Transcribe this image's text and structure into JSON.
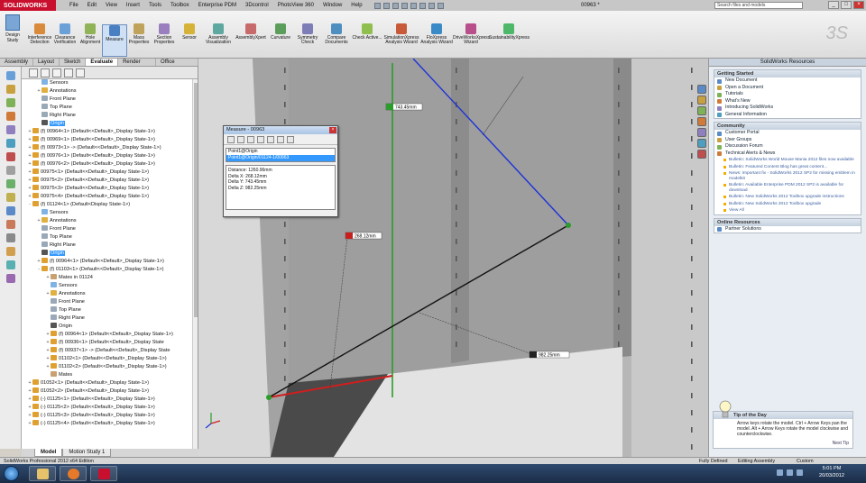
{
  "app": {
    "logo_text": "SOLIDWORKS",
    "menus": [
      "File",
      "Edit",
      "View",
      "Insert",
      "Tools",
      "Toolbox",
      "Enterprise PDM",
      "3Dcontrol",
      "PhotoView 360",
      "Window",
      "Help"
    ],
    "document_title": "00963 *",
    "search_placeholder": "Search files and models"
  },
  "ribbon": {
    "design_study_label": "Design Study",
    "buttons": [
      {
        "label": "Interference Detection",
        "color": "#d98a3a"
      },
      {
        "label": "Clearance Verification",
        "color": "#6a9fd8"
      },
      {
        "label": "Hole Alignment",
        "color": "#8fb356"
      },
      {
        "label": "Measure",
        "color": "#4a7fc1"
      },
      {
        "label": "Mass Properties",
        "color": "#c0a35a"
      },
      {
        "label": "Section Properties",
        "color": "#9a7fbf"
      },
      {
        "label": "Sensor",
        "color": "#d6b338"
      },
      {
        "label": "Assembly Visualization",
        "color": "#5fa8a0"
      },
      {
        "label": "AssemblyXpert",
        "color": "#c96a6a"
      },
      {
        "label": "Curvature",
        "color": "#5b9e5b"
      },
      {
        "label": "Symmetry Check",
        "color": "#7d7db8"
      },
      {
        "label": "Compare Documents",
        "color": "#4e8fbf"
      },
      {
        "label": "Check Active...",
        "color": "#8fbf4e"
      },
      {
        "label": "SimulationXpress Analysis Wizard",
        "color": "#c85a3a"
      },
      {
        "label": "FloXpress Analysis Wizard",
        "color": "#3a8ac8"
      },
      {
        "label": "DriveWorksXpress Wizard",
        "color": "#b84e8a"
      },
      {
        "label": "SustainabilityXpress",
        "color": "#4eb86a"
      }
    ]
  },
  "command_tabs": [
    {
      "label": "Assembly",
      "active": false
    },
    {
      "label": "Layout",
      "active": false
    },
    {
      "label": "Sketch",
      "active": false
    },
    {
      "label": "Evaluate",
      "active": true
    },
    {
      "label": "Render Tools",
      "active": false
    },
    {
      "label": "Office Products",
      "active": false
    }
  ],
  "tree": [
    {
      "indent": 1,
      "tw": "",
      "icon": "#7fb2e5",
      "label": "Sensors"
    },
    {
      "indent": 1,
      "tw": "+",
      "icon": "#e0b040",
      "label": "Annotations"
    },
    {
      "indent": 1,
      "tw": "",
      "icon": "#9aa9b8",
      "label": "Front Plane"
    },
    {
      "indent": 1,
      "tw": "",
      "icon": "#9aa9b8",
      "label": "Top Plane"
    },
    {
      "indent": 1,
      "tw": "",
      "icon": "#9aa9b8",
      "label": "Right Plane"
    },
    {
      "indent": 1,
      "tw": "",
      "icon": "#555555",
      "label": "Origin",
      "selected": true
    },
    {
      "indent": 0,
      "tw": "+",
      "icon": "#e0a030",
      "label": "(f) 00964<1> (Default<<Default>_Display State-1>)"
    },
    {
      "indent": 0,
      "tw": "+",
      "icon": "#e0a030",
      "label": "(f) 00969<1> (Default<<Default>_Display State-1>)"
    },
    {
      "indent": 0,
      "tw": "+",
      "icon": "#e0a030",
      "label": "(f) 00973<1> -> (Default<<Default>_Display State-1>)"
    },
    {
      "indent": 0,
      "tw": "+",
      "icon": "#e0a030",
      "label": "(f) 00976<1> (Default<<Default>_Display State-1>)"
    },
    {
      "indent": 0,
      "tw": "+",
      "icon": "#e0a030",
      "label": "(f) 00976<2> (Default<<Default>_Display State-1>)"
    },
    {
      "indent": 0,
      "tw": "+",
      "icon": "#e0a030",
      "label": "00975<1> (Default<<Default>_Display State-1>)"
    },
    {
      "indent": 0,
      "tw": "+",
      "icon": "#e0a030",
      "label": "00975<2> (Default<<Default>_Display State-1>)"
    },
    {
      "indent": 0,
      "tw": "+",
      "icon": "#e0a030",
      "label": "00975<3> (Default<<Default>_Display State-1>)"
    },
    {
      "indent": 0,
      "tw": "+",
      "icon": "#e0a030",
      "label": "00975<4> (Default<<Default>_Display State-1>)"
    },
    {
      "indent": 0,
      "tw": "-",
      "icon": "#e0a030",
      "label": "(f) 01124<1> (Default<Display State-1>)"
    },
    {
      "indent": 1,
      "tw": "",
      "icon": "#7fb2e5",
      "label": "Sensors"
    },
    {
      "indent": 1,
      "tw": "+",
      "icon": "#e0b040",
      "label": "Annotations"
    },
    {
      "indent": 1,
      "tw": "",
      "icon": "#9aa9b8",
      "label": "Front Plane"
    },
    {
      "indent": 1,
      "tw": "",
      "icon": "#9aa9b8",
      "label": "Top Plane"
    },
    {
      "indent": 1,
      "tw": "",
      "icon": "#9aa9b8",
      "label": "Right Plane"
    },
    {
      "indent": 1,
      "tw": "",
      "icon": "#555555",
      "label": "Origin",
      "selected": true
    },
    {
      "indent": 1,
      "tw": "+",
      "icon": "#e0a030",
      "label": "(f) 00964<1> (Default<<Default>_Display State-1>)"
    },
    {
      "indent": 1,
      "tw": "-",
      "icon": "#e0a030",
      "label": "(f) 01103<1> (Default<<Default>_Display State-1>)"
    },
    {
      "indent": 2,
      "tw": "+",
      "icon": "#c9a070",
      "label": "Mates in 01124"
    },
    {
      "indent": 2,
      "tw": "",
      "icon": "#7fb2e5",
      "label": "Sensors"
    },
    {
      "indent": 2,
      "tw": "+",
      "icon": "#e0b040",
      "label": "Annotations"
    },
    {
      "indent": 2,
      "tw": "",
      "icon": "#9aa9b8",
      "label": "Front Plane"
    },
    {
      "indent": 2,
      "tw": "",
      "icon": "#9aa9b8",
      "label": "Top Plane"
    },
    {
      "indent": 2,
      "tw": "",
      "icon": "#9aa9b8",
      "label": "Right Plane"
    },
    {
      "indent": 2,
      "tw": "",
      "icon": "#555555",
      "label": "Origin"
    },
    {
      "indent": 2,
      "tw": "+",
      "icon": "#e0a030",
      "label": "(f) 00964<1> (Default<<Default>_Display State-1>)"
    },
    {
      "indent": 2,
      "tw": "+",
      "icon": "#e0a030",
      "label": "(f) 00936<1> (Default<<Default>_Display State"
    },
    {
      "indent": 2,
      "tw": "+",
      "icon": "#e0a030",
      "label": "(f) 00937<1> -> (Default<<Default>_Display State"
    },
    {
      "indent": 2,
      "tw": "+",
      "icon": "#e0a030",
      "label": "01102<1> (Default<<Default>_Display State-1>)"
    },
    {
      "indent": 2,
      "tw": "+",
      "icon": "#e0a030",
      "label": "01102<2> (Default<<Default>_Display State-1>)"
    },
    {
      "indent": 2,
      "tw": "",
      "icon": "#c9a070",
      "label": "Mates"
    },
    {
      "indent": 0,
      "tw": "+",
      "icon": "#e0a030",
      "label": "01052<1> (Default<<Default>_Display State-1>)"
    },
    {
      "indent": 0,
      "tw": "+",
      "icon": "#e0a030",
      "label": "01052<2> (Default<<Default>_Display State-1>)"
    },
    {
      "indent": 0,
      "tw": "+",
      "icon": "#e0a030",
      "label": "(-) 01125<1> (Default<<Default>_Display State-1>)"
    },
    {
      "indent": 0,
      "tw": "+",
      "icon": "#e0a030",
      "label": "(-) 01125<2> (Default<<Default>_Display State-1>)"
    },
    {
      "indent": 0,
      "tw": "+",
      "icon": "#e0a030",
      "label": "(-) 01125<3> (Default<<Default>_Display State-1>)"
    },
    {
      "indent": 0,
      "tw": "+",
      "icon": "#e0a030",
      "label": "(-) 01125<4> (Default<<Default>_Display State-1>)"
    }
  ],
  "model_tabs": [
    {
      "label": "Model",
      "active": true
    },
    {
      "label": "Motion Study 1",
      "active": false
    }
  ],
  "viewport": {
    "labels": [
      {
        "text": "743.45mm",
        "color": "#2a9d2a"
      },
      {
        "text": "268.12mm",
        "color": "#c81e1e"
      },
      {
        "text": "982.25mm",
        "color": "#222222"
      }
    ]
  },
  "measure": {
    "title": "Measure - 00963",
    "selections": [
      "Point1@Origin",
      "Point1@Origin/01124-1/00963"
    ],
    "results": [
      "Distance: 1260.96mm",
      "Delta X: 268.12mm",
      "Delta Y: 743.45mm",
      "Delta Z: 982.25mm"
    ]
  },
  "taskpane": {
    "title": "SolidWorks Resources",
    "getting_started": {
      "title": "Getting Started",
      "items": [
        "New Document",
        "Open a Document",
        "Tutorials",
        "What's New",
        "Introducing SolidWorks",
        "General Information"
      ]
    },
    "community": {
      "title": "Community",
      "items": [
        "Customer Portal",
        "User Groups",
        "Discussion Forum",
        "Technical Alerts & News"
      ],
      "news": [
        "Bulletin: SolidWorks World Mouse Mania 2012 files now available",
        "Bulletin: Featured Content Blog has great content...",
        "News: Important fix - SolidWorks 2012 SP2 for missing emblem in modelkit",
        "Bulletin: Available Enterprise PDM 2012 SP2 is available for download",
        "Bulletin: New SolidWorks 2012 Toolbox upgrade instructions",
        "Bulletin: New SolidWorks 2012 Toolbox upgrade"
      ],
      "view_all": "View All"
    },
    "online_resources": {
      "title": "Online Resources",
      "items": [
        "Partner Solutions"
      ]
    },
    "tip": {
      "title": "Tip of the Day",
      "text": "Arrow keys rotate the model. Ctrl + Arrow Keys pan the model. Alt + Arrow Keys rotate the model clockwise and counterclockwise.",
      "next": "Next Tip"
    }
  },
  "status": {
    "left": "SolidWorks Professional 2012 x64 Edition",
    "state": "Fully Defined",
    "mode": "Editing Assembly",
    "units": "Custom"
  },
  "taskbar": {
    "time": "5:01 PM",
    "date": "20/03/2012"
  }
}
